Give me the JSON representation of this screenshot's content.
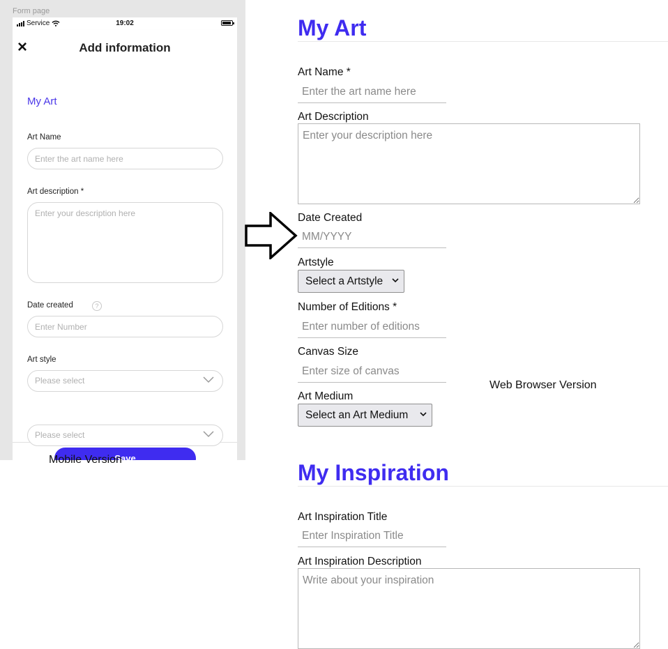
{
  "mobile": {
    "frame_label": "Form page",
    "status": {
      "carrier": "Service",
      "time": "19:02"
    },
    "header": {
      "title": "Add information",
      "close_icon": "close-icon"
    },
    "section_title": "My Art",
    "fields": {
      "art_name": {
        "label": "Art Name",
        "placeholder": "Enter the art name here"
      },
      "art_description": {
        "label": "Art description *",
        "placeholder": "Enter your description here"
      },
      "date_created": {
        "label": "Date created",
        "help": "?",
        "placeholder": "Enter Number"
      },
      "art_style": {
        "label": "Art style",
        "value": "Please select"
      },
      "second_select": {
        "value": "Please select"
      }
    },
    "save_label": "Save",
    "caption": "Mobile Version"
  },
  "web": {
    "section1_title": "My Art",
    "art_name": {
      "label": "Art Name *",
      "placeholder": "Enter the art name here"
    },
    "art_description": {
      "label": "Art Description",
      "placeholder": "Enter your description here"
    },
    "date_created": {
      "label": "Date Created",
      "placeholder": "MM/YYYY"
    },
    "artstyle": {
      "label": "Artstyle",
      "value": "Select a Artstyle"
    },
    "editions": {
      "label": "Number of Editions *",
      "placeholder": "Enter number of editions"
    },
    "canvas_size": {
      "label": "Canvas Size",
      "placeholder": "Enter size of canvas"
    },
    "art_medium": {
      "label": "Art Medium",
      "value": "Select an Art Medium"
    },
    "section2_title": "My Inspiration",
    "inspiration_title": {
      "label": "Art Inspiration Title",
      "placeholder": "Enter Inspiration Title"
    },
    "inspiration_description": {
      "label": "Art Inspiration Description",
      "placeholder": "Write about your inspiration"
    },
    "caption": "Web Browser Version"
  },
  "colors": {
    "accent": "#3f2cf0",
    "section_text": "#4a37e8"
  },
  "icons": {
    "arrow": "right-arrow-icon"
  }
}
